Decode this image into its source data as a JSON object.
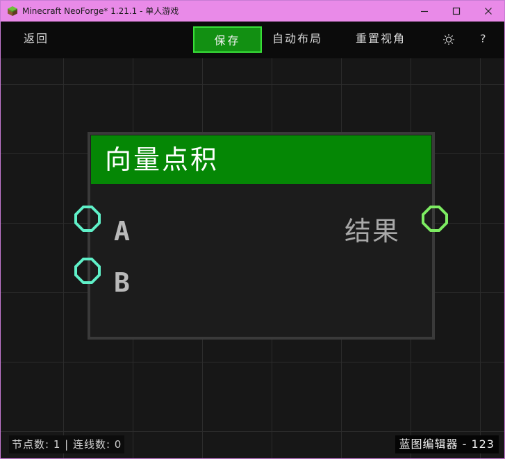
{
  "window": {
    "title": "Minecraft NeoForge* 1.21.1 - 单人游戏",
    "app_icon": "minecraft-grass-block-icon",
    "controls": [
      "minimize-icon",
      "maximize-icon",
      "close-icon"
    ],
    "titlebar_color": "#e98ae8"
  },
  "toolbar": {
    "back_label": "返回",
    "save_label": "保存",
    "auto_layout_label": "自动布局",
    "reset_view_label": "重置视角",
    "settings_icon": "sun-gear-icon",
    "help_label": "?",
    "save_color": "#129012"
  },
  "node": {
    "title": "向量点积",
    "header_color": "#058705",
    "inputs": [
      {
        "label": "A",
        "port_color": "#5ff0c8"
      },
      {
        "label": "B",
        "port_color": "#5ff0c8"
      }
    ],
    "outputs": [
      {
        "label": "结果",
        "port_color": "#7dec62"
      }
    ]
  },
  "status": {
    "left": "节点数: 1 | 连线数: 0",
    "right": "蓝图编辑器 - 123"
  }
}
